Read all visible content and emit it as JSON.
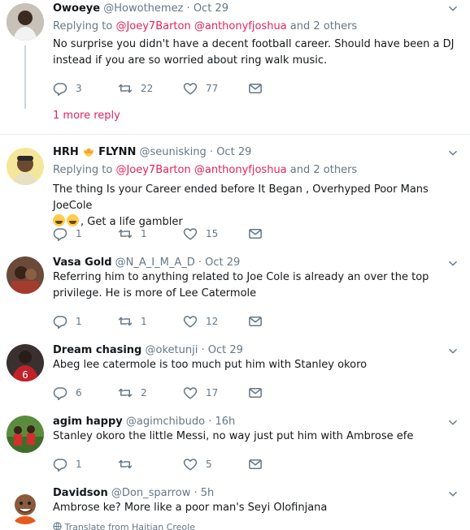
{
  "tweets": [
    {
      "name": "Owoeye",
      "handle": "@Howothemez",
      "time": "Oct 29",
      "replying_prefix": "Replying to",
      "mention1": "@Joey7Barton",
      "mention2": "@anthonyfjoshua",
      "replying_suffix": "and 2 others",
      "text": "No surprise you didn't have a decent football career. Should have been a DJ instead if you are so worried about ring walk music.",
      "replies": "3",
      "retweets": "22",
      "likes": "77",
      "more_reply": "1 more reply"
    },
    {
      "name": "HRH",
      "name_suffix": "FLYNN",
      "handle": "@seunisking",
      "time": "Oct 29",
      "replying_prefix": "Replying to",
      "mention1": "@Joey7Barton",
      "mention2": "@anthonyfjoshua",
      "replying_suffix": "and 2 others",
      "text": "The thing Is your Career ended before It Began , Overhyped Poor Mans JoeCole",
      "text_tail": ", Get a life gambler",
      "replies": "1",
      "retweets": "1",
      "likes": "15"
    },
    {
      "name": "Vasa Gold",
      "handle": "@N_A_I_M_A_D",
      "time": "Oct 29",
      "text": "Referring him to anything related to Joe Cole is already an over the top privilege. He is more of  Lee Catermole",
      "replies": "1",
      "retweets": "1",
      "likes": "12"
    },
    {
      "name": "Dream chasing",
      "handle": "@oketunji",
      "time": "Oct 29",
      "text": "Abeg lee catermole is too much put him with Stanley okoro",
      "replies": "6",
      "retweets": "2",
      "likes": "17"
    },
    {
      "name": "agim happy",
      "handle": "@agimchibudo",
      "time": "16h",
      "text": "Stanley okoro the little Messi, no way just put him with Ambrose efe",
      "replies": "1",
      "retweets": "",
      "likes": "5"
    },
    {
      "name": "Davidson",
      "handle": "@Don_sparrow",
      "time": "5h",
      "text": "Ambrose ke? More like a poor man's Seyi Olofinjana",
      "translate": "Translate from Haitian Creole"
    }
  ],
  "dot": "·",
  "icons": [
    "reply-icon",
    "retweet-icon",
    "like-icon",
    "direct-message-icon",
    "chevron-down-icon",
    "globe-icon",
    "crown-emoji",
    "joy-emoji"
  ]
}
